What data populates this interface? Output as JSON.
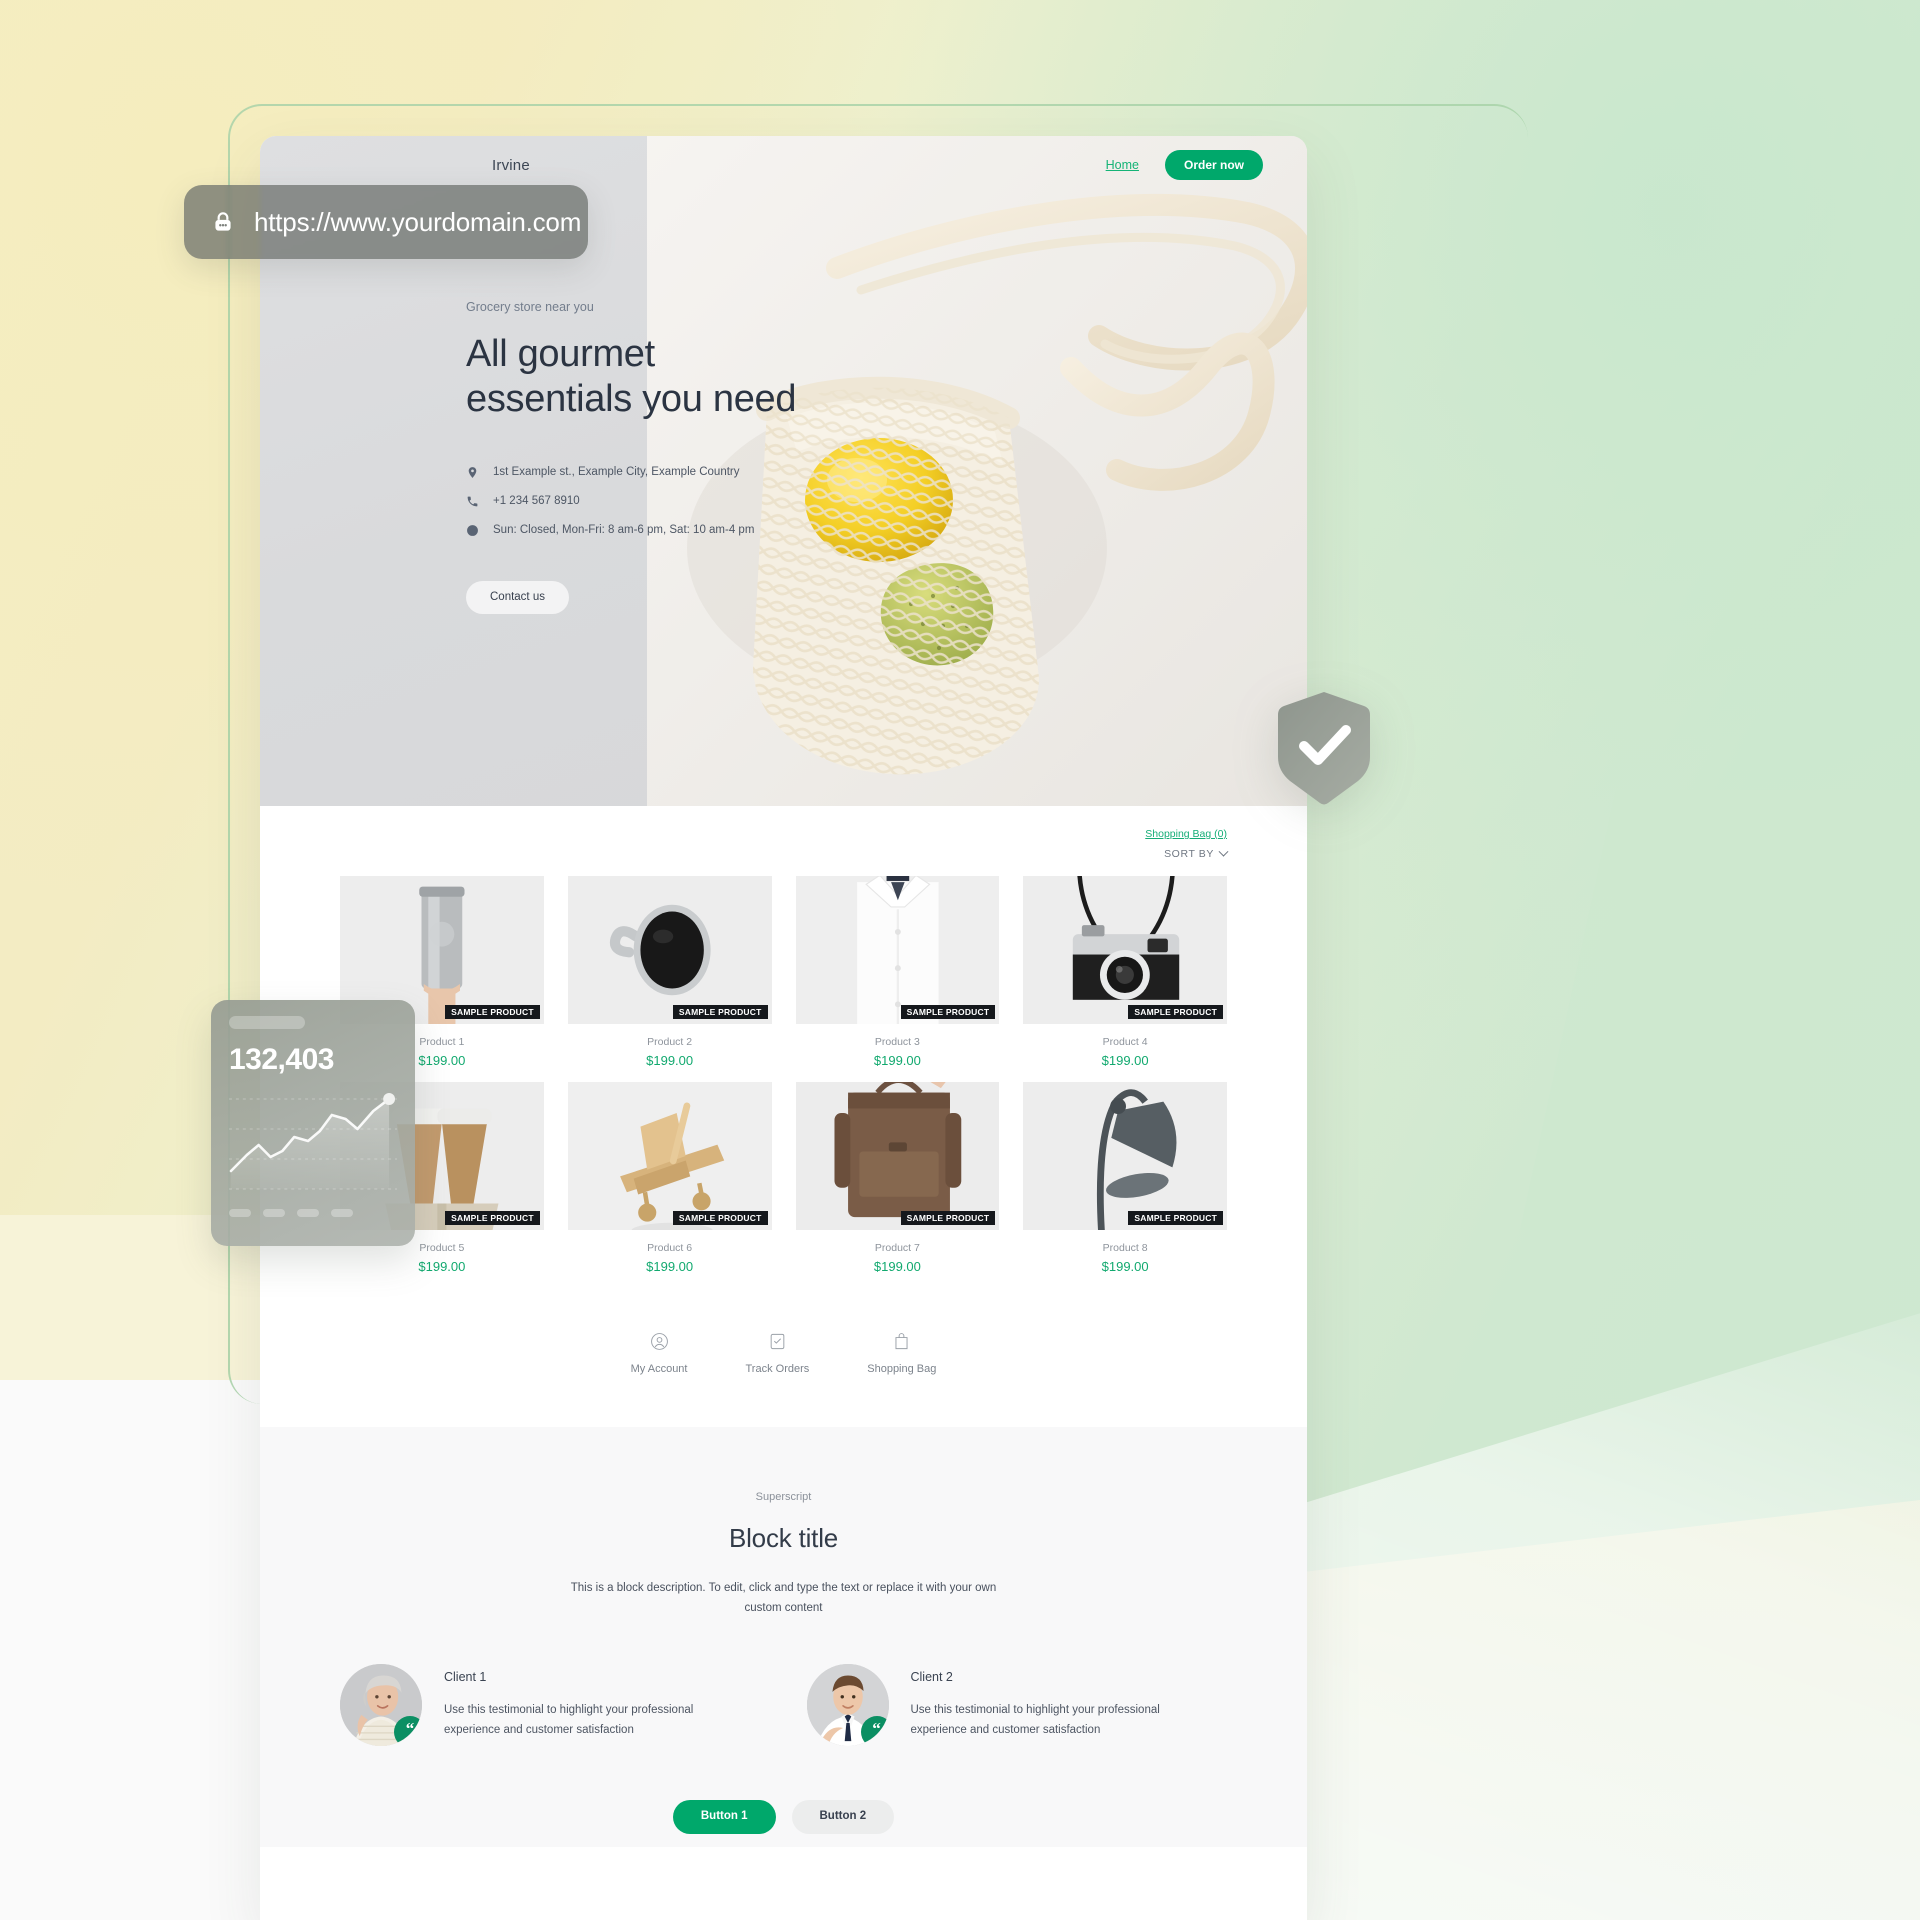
{
  "background": {
    "gradient_start": "#f4eec4",
    "gradient_end": "#cde8d1",
    "frame_outline_color": "#a9d3a9"
  },
  "url_bar": {
    "icon": "lock-icon",
    "url": "https://www.yourdomain.com"
  },
  "site": {
    "header": {
      "brand": "Irvine",
      "nav": [
        {
          "label": "Home"
        }
      ],
      "cta_label": "Order now",
      "cta_color": "#00a86b"
    },
    "hero": {
      "eyebrow": "Grocery store near you",
      "title_line1": "All gourmet",
      "title_line2": "essentials you need",
      "info": [
        {
          "icon": "map-pin-icon",
          "text": "1st Example st., Example City, Example Country"
        },
        {
          "icon": "phone-icon",
          "text": "+1 234 567 8910"
        },
        {
          "icon": "clock-icon",
          "text": "Sun: Closed, Mon-Fri: 8 am-6 pm, Sat: 10 am-4 pm"
        }
      ],
      "cta_label": "Contact us",
      "image_alt": "mesh-tote-bag-with-lemon"
    },
    "products": {
      "bag_link": "Shopping Bag (0)",
      "sort_label": "SORT BY",
      "sort_icon": "chevron-down-icon",
      "badge_text": "SAMPLE PRODUCT",
      "items": [
        {
          "name": "Product 1",
          "price": "$199.00",
          "image": "hand-holding-steel-tumbler"
        },
        {
          "name": "Product 2",
          "price": "$199.00",
          "image": "black-coffee-mug-top-view"
        },
        {
          "name": "Product 3",
          "price": "$199.00",
          "image": "white-dress-shirt"
        },
        {
          "name": "Product 4",
          "price": "$199.00",
          "image": "vintage-film-camera"
        },
        {
          "name": "Product 5",
          "price": "$199.00",
          "image": "two-paper-coffee-cups-in-tray"
        },
        {
          "name": "Product 6",
          "price": "$199.00",
          "image": "wooden-toy-airplane"
        },
        {
          "name": "Product 7",
          "price": "$199.00",
          "image": "hand-holding-leather-bag"
        },
        {
          "name": "Product 8",
          "price": "$199.00",
          "image": "grey-desk-lamp"
        }
      ],
      "quick_nav": [
        {
          "icon": "user-circle-icon",
          "label": "My Account"
        },
        {
          "icon": "checklist-icon",
          "label": "Track Orders"
        },
        {
          "icon": "shopping-bag-icon",
          "label": "Shopping Bag"
        }
      ]
    },
    "block": {
      "superscript": "Superscript",
      "title": "Block title",
      "description": "This is a block description. To edit, click and type the text or replace it with your own custom content",
      "testimonials": [
        {
          "name": "Client 1",
          "text": "Use this testimonial to highlight your professional experience and customer satisfaction",
          "avatar": "older-woman-smiling",
          "badge_icon": "quote-icon"
        },
        {
          "name": "Client 2",
          "text": "Use this testimonial to highlight your professional experience and customer satisfaction",
          "avatar": "young-man-in-shirt-and-tie",
          "badge_icon": "quote-icon"
        }
      ],
      "buttons": [
        {
          "label": "Button 1",
          "style": "primary",
          "color": "#00a86b"
        },
        {
          "label": "Button 2",
          "style": "secondary",
          "color": "#eceded"
        }
      ]
    }
  },
  "stats_card": {
    "value": "132,403",
    "skeleton_title": "",
    "chart_type": "area-sparkline"
  },
  "shield_badge": {
    "icon": "shield-check-icon"
  }
}
